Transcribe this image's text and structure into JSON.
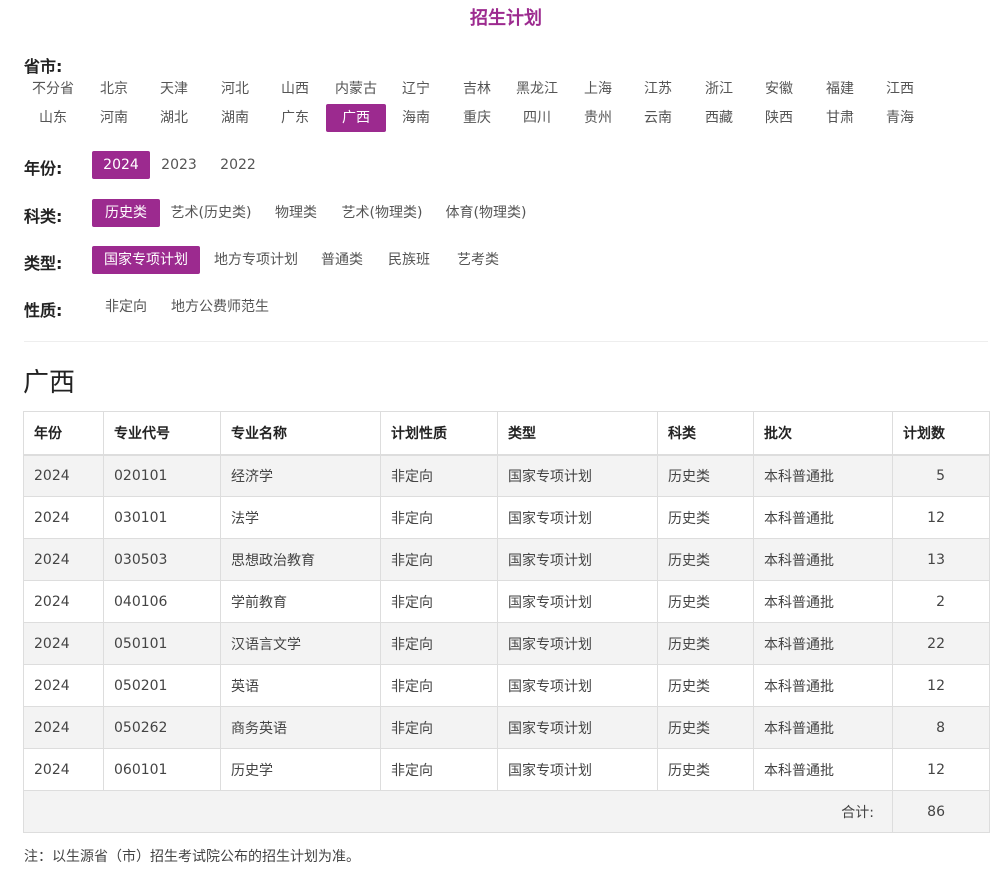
{
  "page": {
    "title": "招生计划"
  },
  "filters": {
    "province": {
      "label": "省市:",
      "options": [
        "不分省",
        "北京",
        "天津",
        "河北",
        "山西",
        "内蒙古",
        "辽宁",
        "吉林",
        "黑龙江",
        "上海",
        "江苏",
        "浙江",
        "安徽",
        "福建",
        "江西",
        "山东",
        "河南",
        "湖北",
        "湖南",
        "广东",
        "广西",
        "海南",
        "重庆",
        "四川",
        "贵州",
        "云南",
        "西藏",
        "陕西",
        "甘肃",
        "青海"
      ],
      "selected": "广西"
    },
    "year": {
      "label": "年份:",
      "options": [
        "2024",
        "2023",
        "2022"
      ],
      "selected": "2024"
    },
    "subject": {
      "label": "科类:",
      "options": [
        "历史类",
        "艺术(历史类)",
        "物理类",
        "艺术(物理类)",
        "体育(物理类)"
      ],
      "selected": "历史类"
    },
    "type": {
      "label": "类型:",
      "options": [
        "国家专项计划",
        "地方专项计划",
        "普通类",
        "民族班",
        "艺考类"
      ],
      "selected": "国家专项计划"
    },
    "nature": {
      "label": "性质:",
      "options": [
        "非定向",
        "地方公费师范生"
      ],
      "selected": ""
    }
  },
  "result": {
    "province_title": "广西",
    "columns": [
      "年份",
      "专业代号",
      "专业名称",
      "计划性质",
      "类型",
      "科类",
      "批次",
      "计划数"
    ],
    "rows": [
      [
        "2024",
        "020101",
        "经济学",
        "非定向",
        "国家专项计划",
        "历史类",
        "本科普通批",
        "5"
      ],
      [
        "2024",
        "030101",
        "法学",
        "非定向",
        "国家专项计划",
        "历史类",
        "本科普通批",
        "12"
      ],
      [
        "2024",
        "030503",
        "思想政治教育",
        "非定向",
        "国家专项计划",
        "历史类",
        "本科普通批",
        "13"
      ],
      [
        "2024",
        "040106",
        "学前教育",
        "非定向",
        "国家专项计划",
        "历史类",
        "本科普通批",
        "2"
      ],
      [
        "2024",
        "050101",
        "汉语言文学",
        "非定向",
        "国家专项计划",
        "历史类",
        "本科普通批",
        "22"
      ],
      [
        "2024",
        "050201",
        "英语",
        "非定向",
        "国家专项计划",
        "历史类",
        "本科普通批",
        "12"
      ],
      [
        "2024",
        "050262",
        "商务英语",
        "非定向",
        "国家专项计划",
        "历史类",
        "本科普通批",
        "8"
      ],
      [
        "2024",
        "060101",
        "历史学",
        "非定向",
        "国家专项计划",
        "历史类",
        "本科普通批",
        "12"
      ]
    ],
    "total_label": "合计:",
    "total_value": "86"
  },
  "note": "注：以生源省（市）招生考试院公布的招生计划为准。",
  "colors": {
    "accent": "#9c2a8f"
  }
}
